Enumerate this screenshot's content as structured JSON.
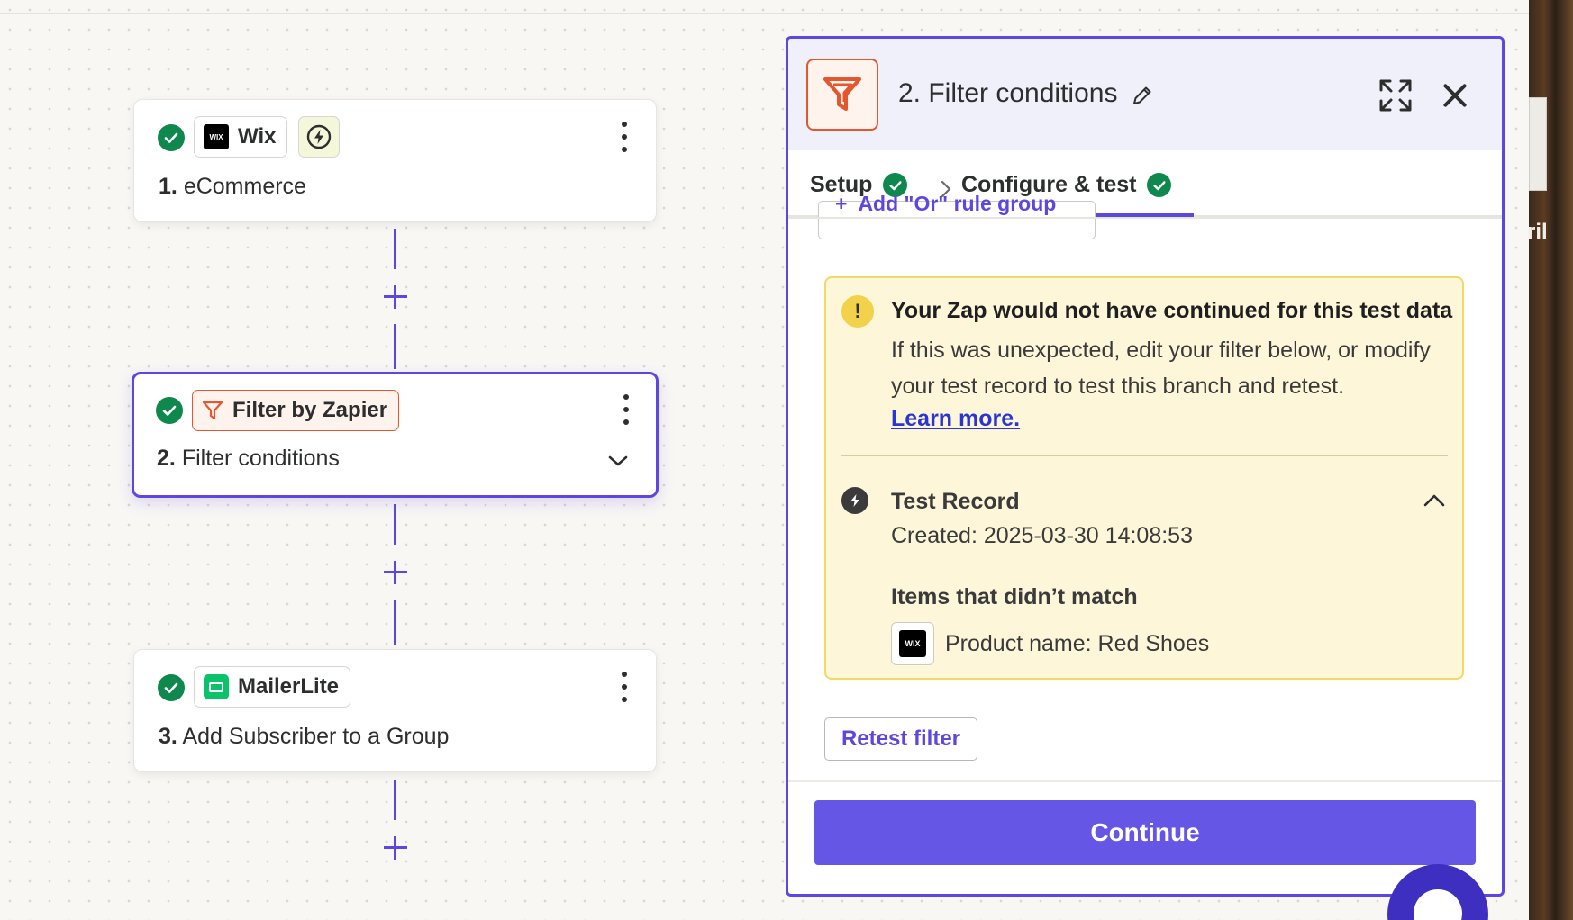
{
  "colors": {
    "accent": "#5c47e0",
    "success": "#0f884e",
    "filter_orange": "#e4572e",
    "warning_bg": "#fdf6d9",
    "warning_border": "#f0d967"
  },
  "right_strip": {
    "text": "ril"
  },
  "steps": [
    {
      "number": "1.",
      "title": "eCommerce",
      "app": "Wix",
      "app_icon": "wix-logo-icon",
      "has_trigger_icon": true
    },
    {
      "number": "2.",
      "title": "Filter conditions",
      "app": "Filter by Zapier",
      "app_icon": "filter-funnel-icon",
      "selected": true
    },
    {
      "number": "3.",
      "title": "Add Subscriber to a Group",
      "app": "MailerLite",
      "app_icon": "mailerlite-logo-icon"
    }
  ],
  "panel": {
    "title": "2. Filter conditions",
    "tabs": [
      {
        "label": "Setup",
        "complete": true
      },
      {
        "label": "Configure & test",
        "complete": true,
        "active": true
      }
    ],
    "clipped_button": {
      "plus": "+",
      "text": "Add \"Or\" rule group"
    },
    "alert": {
      "title": "Your Zap would not have continued for this test data",
      "body": "If this was unexpected, edit your filter below, or modify your test record to test this branch and retest.",
      "link": "Learn more.",
      "test_record": {
        "title": "Test Record",
        "created": "Created: 2025-03-30 14:08:53",
        "items_heading": "Items that didn’t match",
        "item": "Product name: Red Shoes",
        "item_icon": "wix-logo-icon",
        "expanded": true
      }
    },
    "retest_label": "Retest filter",
    "continue_label": "Continue"
  }
}
